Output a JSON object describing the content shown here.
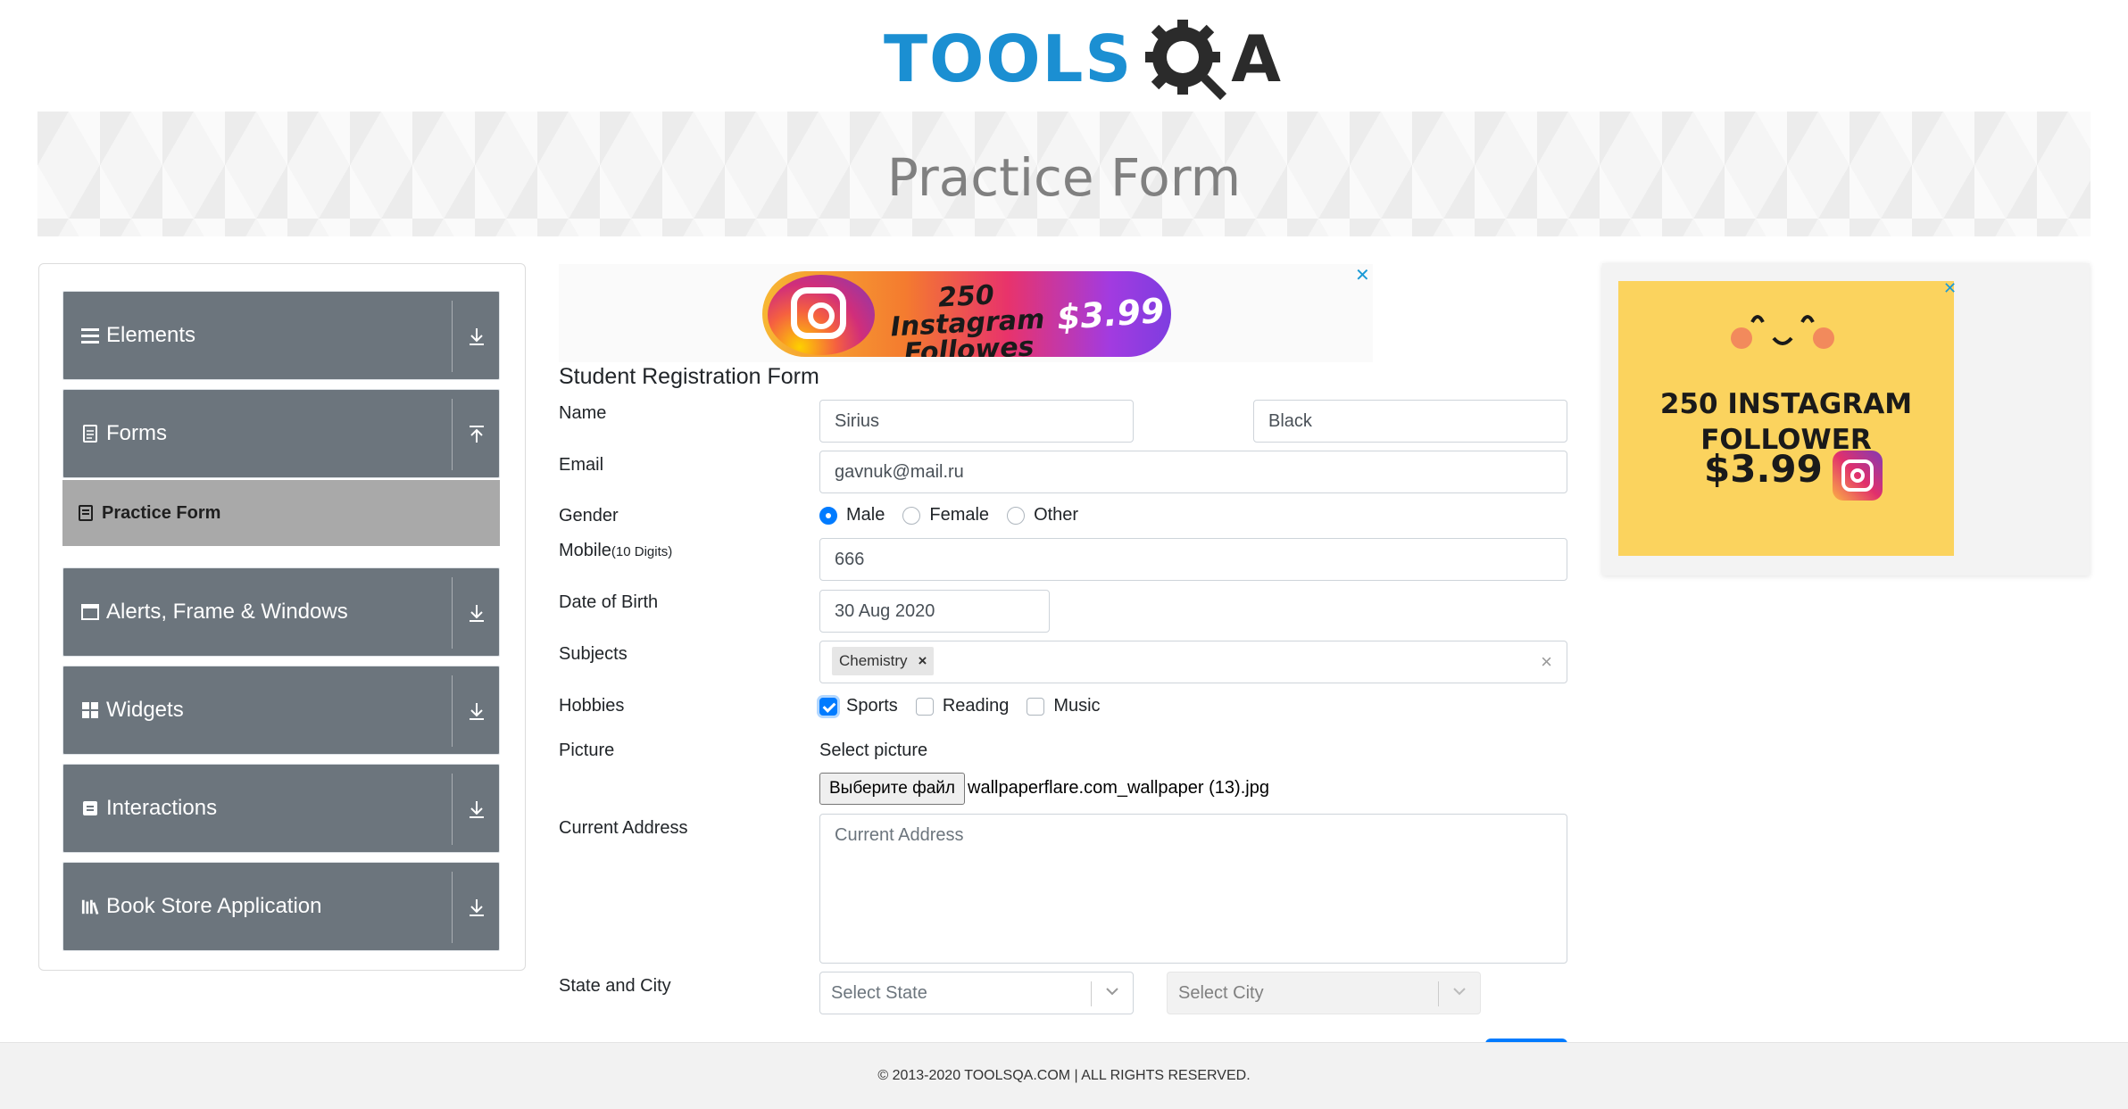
{
  "logo": {
    "text_main": "TOOLS",
    "text_q": "Q",
    "text_a": "A"
  },
  "banner": {
    "title": "Practice Form"
  },
  "sidebar": {
    "groups": [
      {
        "label": "Elements",
        "icon": "menu-icon",
        "arrow": "download-arrow-icon"
      },
      {
        "label": "Forms",
        "icon": "document-icon",
        "arrow": "upload-arrow-icon"
      },
      {
        "label": "Alerts, Frame & Windows",
        "icon": "window-icon",
        "arrow": "download-arrow-icon"
      },
      {
        "label": "Widgets",
        "icon": "grid-icon",
        "arrow": "download-arrow-icon"
      },
      {
        "label": "Interactions",
        "icon": "interaction-icon",
        "arrow": "download-arrow-icon"
      },
      {
        "label": "Book Store Application",
        "icon": "books-icon",
        "arrow": "download-arrow-icon"
      }
    ],
    "active_item": {
      "label": "Practice Form"
    }
  },
  "ads": {
    "top": {
      "line1": "250 Instagram",
      "line2": "Followes",
      "price": "$3.99",
      "close": "✕"
    },
    "right": {
      "line1": "250 INSTAGRAM",
      "line2": "FOLLOWER",
      "price": "$3.99",
      "close": "✕"
    }
  },
  "form": {
    "title": "Student Registration Form",
    "labels": {
      "name": "Name",
      "email": "Email",
      "gender": "Gender",
      "mobile": "Mobile",
      "mobile_hint": "(10 Digits)",
      "dob": "Date of Birth",
      "subjects": "Subjects",
      "hobbies": "Hobbies",
      "picture": "Picture",
      "address": "Current Address",
      "state_city": "State and City"
    },
    "first_name": "Sirius",
    "last_name": "Black",
    "email": "gavnuk@mail.ru",
    "gender_options": [
      "Male",
      "Female",
      "Other"
    ],
    "gender_selected": "Male",
    "mobile": "666",
    "dob": "30 Aug 2020",
    "subjects": [
      "Chemistry"
    ],
    "subject_remove": "×",
    "subjects_clear": "×",
    "hobbies": [
      {
        "label": "Sports",
        "checked": true
      },
      {
        "label": "Reading",
        "checked": false
      },
      {
        "label": "Music",
        "checked": false
      }
    ],
    "picture_label": "Select picture",
    "file_button": "Выберите файл",
    "file_name": "wallpaperflare.com_wallpaper (13).jpg",
    "address_placeholder": "Current Address",
    "state_placeholder": "Select State",
    "city_placeholder": "Select City"
  },
  "footer": {
    "text": "© 2013-2020 TOOLSQA.COM | ALL RIGHTS RESERVED."
  },
  "colors": {
    "accent": "#007bff",
    "sidebar": "#6c757d",
    "active_item": "#a9a9a9",
    "logo_blue": "#1b8fd2"
  }
}
